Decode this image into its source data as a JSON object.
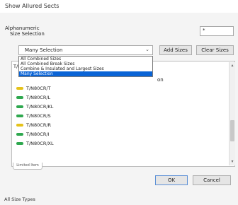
{
  "window": {
    "title": "Show Allured Sects"
  },
  "alphanumeric_label": "Alphanumeric",
  "size_selection_label": "Size Selection",
  "top_field_value": "*",
  "size_select": {
    "selected": "Many Selection",
    "options": [
      "All Combined Sizes",
      "All Combined Break Sizes",
      "Combine & Insulated and Largest Sizes",
      "Many Selection"
    ]
  },
  "buttons": {
    "add_sizes": "Add Sizes",
    "clear_sizes": "Clear Sizes",
    "ok": "OK",
    "cancel": "Cancel"
  },
  "list": {
    "prefix": "T/N",
    "header_right": "on",
    "items": [
      {
        "label": "T/N80CR/T",
        "color": "#e5c21a"
      },
      {
        "label": "T/N80CR/L",
        "color": "#2fa84f"
      },
      {
        "label": "T/N80CR/KL",
        "color": "#2fa84f"
      },
      {
        "label": "T/N80CR/S",
        "color": "#2fa84f"
      },
      {
        "label": "T/N80CR/R",
        "color": "#e5c21a"
      },
      {
        "label": "T/N80CR/I",
        "color": "#2fa84f"
      },
      {
        "label": "T/N80CR/XL",
        "color": "#2fa84f"
      }
    ],
    "tag": "Limited Item"
  },
  "footer_label": "All Size Types"
}
